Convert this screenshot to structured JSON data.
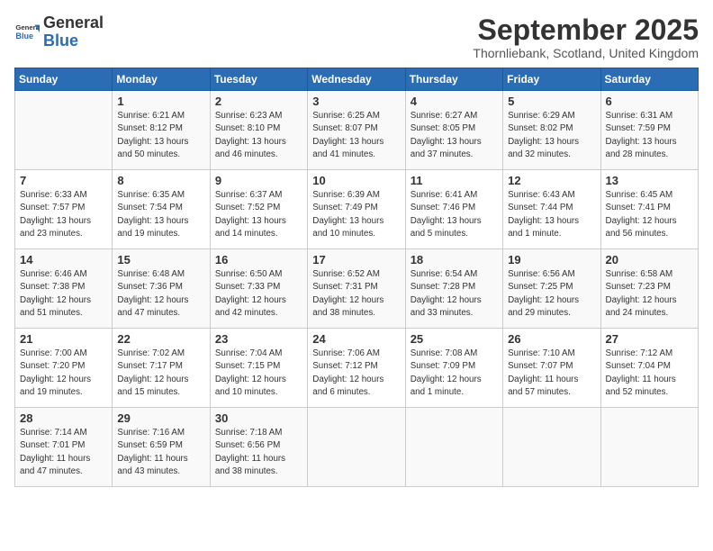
{
  "header": {
    "logo_general": "General",
    "logo_blue": "Blue",
    "month": "September 2025",
    "location": "Thornliebank, Scotland, United Kingdom"
  },
  "days_of_week": [
    "Sunday",
    "Monday",
    "Tuesday",
    "Wednesday",
    "Thursday",
    "Friday",
    "Saturday"
  ],
  "weeks": [
    [
      {
        "day": "",
        "info": ""
      },
      {
        "day": "1",
        "info": "Sunrise: 6:21 AM\nSunset: 8:12 PM\nDaylight: 13 hours\nand 50 minutes."
      },
      {
        "day": "2",
        "info": "Sunrise: 6:23 AM\nSunset: 8:10 PM\nDaylight: 13 hours\nand 46 minutes."
      },
      {
        "day": "3",
        "info": "Sunrise: 6:25 AM\nSunset: 8:07 PM\nDaylight: 13 hours\nand 41 minutes."
      },
      {
        "day": "4",
        "info": "Sunrise: 6:27 AM\nSunset: 8:05 PM\nDaylight: 13 hours\nand 37 minutes."
      },
      {
        "day": "5",
        "info": "Sunrise: 6:29 AM\nSunset: 8:02 PM\nDaylight: 13 hours\nand 32 minutes."
      },
      {
        "day": "6",
        "info": "Sunrise: 6:31 AM\nSunset: 7:59 PM\nDaylight: 13 hours\nand 28 minutes."
      }
    ],
    [
      {
        "day": "7",
        "info": "Sunrise: 6:33 AM\nSunset: 7:57 PM\nDaylight: 13 hours\nand 23 minutes."
      },
      {
        "day": "8",
        "info": "Sunrise: 6:35 AM\nSunset: 7:54 PM\nDaylight: 13 hours\nand 19 minutes."
      },
      {
        "day": "9",
        "info": "Sunrise: 6:37 AM\nSunset: 7:52 PM\nDaylight: 13 hours\nand 14 minutes."
      },
      {
        "day": "10",
        "info": "Sunrise: 6:39 AM\nSunset: 7:49 PM\nDaylight: 13 hours\nand 10 minutes."
      },
      {
        "day": "11",
        "info": "Sunrise: 6:41 AM\nSunset: 7:46 PM\nDaylight: 13 hours\nand 5 minutes."
      },
      {
        "day": "12",
        "info": "Sunrise: 6:43 AM\nSunset: 7:44 PM\nDaylight: 13 hours\nand 1 minute."
      },
      {
        "day": "13",
        "info": "Sunrise: 6:45 AM\nSunset: 7:41 PM\nDaylight: 12 hours\nand 56 minutes."
      }
    ],
    [
      {
        "day": "14",
        "info": "Sunrise: 6:46 AM\nSunset: 7:38 PM\nDaylight: 12 hours\nand 51 minutes."
      },
      {
        "day": "15",
        "info": "Sunrise: 6:48 AM\nSunset: 7:36 PM\nDaylight: 12 hours\nand 47 minutes."
      },
      {
        "day": "16",
        "info": "Sunrise: 6:50 AM\nSunset: 7:33 PM\nDaylight: 12 hours\nand 42 minutes."
      },
      {
        "day": "17",
        "info": "Sunrise: 6:52 AM\nSunset: 7:31 PM\nDaylight: 12 hours\nand 38 minutes."
      },
      {
        "day": "18",
        "info": "Sunrise: 6:54 AM\nSunset: 7:28 PM\nDaylight: 12 hours\nand 33 minutes."
      },
      {
        "day": "19",
        "info": "Sunrise: 6:56 AM\nSunset: 7:25 PM\nDaylight: 12 hours\nand 29 minutes."
      },
      {
        "day": "20",
        "info": "Sunrise: 6:58 AM\nSunset: 7:23 PM\nDaylight: 12 hours\nand 24 minutes."
      }
    ],
    [
      {
        "day": "21",
        "info": "Sunrise: 7:00 AM\nSunset: 7:20 PM\nDaylight: 12 hours\nand 19 minutes."
      },
      {
        "day": "22",
        "info": "Sunrise: 7:02 AM\nSunset: 7:17 PM\nDaylight: 12 hours\nand 15 minutes."
      },
      {
        "day": "23",
        "info": "Sunrise: 7:04 AM\nSunset: 7:15 PM\nDaylight: 12 hours\nand 10 minutes."
      },
      {
        "day": "24",
        "info": "Sunrise: 7:06 AM\nSunset: 7:12 PM\nDaylight: 12 hours\nand 6 minutes."
      },
      {
        "day": "25",
        "info": "Sunrise: 7:08 AM\nSunset: 7:09 PM\nDaylight: 12 hours\nand 1 minute."
      },
      {
        "day": "26",
        "info": "Sunrise: 7:10 AM\nSunset: 7:07 PM\nDaylight: 11 hours\nand 57 minutes."
      },
      {
        "day": "27",
        "info": "Sunrise: 7:12 AM\nSunset: 7:04 PM\nDaylight: 11 hours\nand 52 minutes."
      }
    ],
    [
      {
        "day": "28",
        "info": "Sunrise: 7:14 AM\nSunset: 7:01 PM\nDaylight: 11 hours\nand 47 minutes."
      },
      {
        "day": "29",
        "info": "Sunrise: 7:16 AM\nSunset: 6:59 PM\nDaylight: 11 hours\nand 43 minutes."
      },
      {
        "day": "30",
        "info": "Sunrise: 7:18 AM\nSunset: 6:56 PM\nDaylight: 11 hours\nand 38 minutes."
      },
      {
        "day": "",
        "info": ""
      },
      {
        "day": "",
        "info": ""
      },
      {
        "day": "",
        "info": ""
      },
      {
        "day": "",
        "info": ""
      }
    ]
  ]
}
